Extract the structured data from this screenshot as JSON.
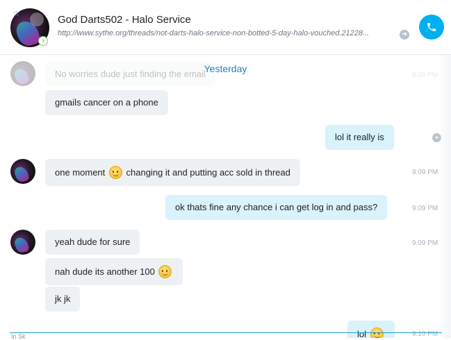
{
  "header": {
    "contact_name": "God Darts502 - Halo Service",
    "mood_link": "http://www.sythe.org/threads/not-darts-halo-service-non-botted-5-day-halo-vouched.21228...",
    "favorite_icon": "star-outline-icon",
    "presence_icon": "online-arrow-icon",
    "call_icon": "phone-icon",
    "accent_color": "#00aff0"
  },
  "day_separator": "Yesterday",
  "messages": [
    {
      "text": "No worries dude just finding the email",
      "direction": "in",
      "time": "9:09 PM"
    },
    {
      "text": "gmails cancer on a phone",
      "direction": "in"
    },
    {
      "text": "lol it really is",
      "direction": "out"
    },
    {
      "text_before": "one moment",
      "text_after": "changing it and putting acc sold in thread",
      "direction": "in",
      "time": "9:09 PM",
      "emoji": "smile-emoji"
    },
    {
      "text": "ok thats fine any chance i can get log in and pass?",
      "direction": "out",
      "time": "9:09 PM"
    },
    {
      "text": "yeah dude for sure",
      "direction": "in",
      "time": "9:09 PM"
    },
    {
      "text": "nah dude its another 100",
      "direction": "in",
      "emoji": "smirk-emoji"
    },
    {
      "text": "jk jk",
      "direction": "in"
    },
    {
      "text": "lol",
      "direction": "out",
      "time": "9:10 PM",
      "emoji": "laugh-emoji"
    }
  ],
  "composer": {
    "text": "In Sk"
  }
}
